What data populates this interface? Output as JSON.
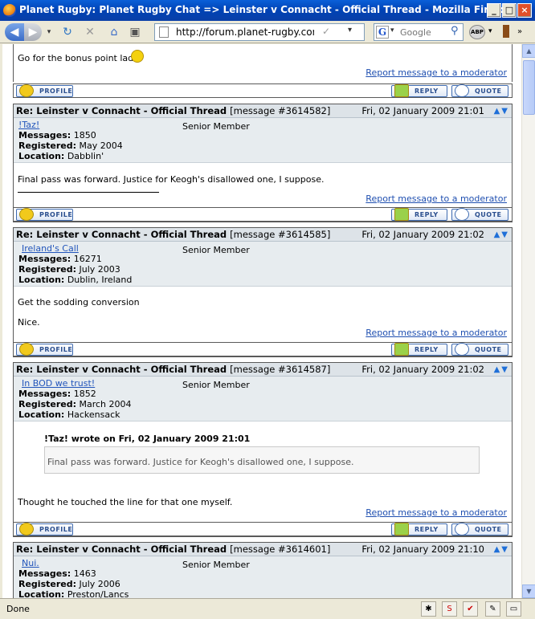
{
  "window": {
    "title": "Planet Rugby: Planet Rugby Chat => Leinster v Connacht - Official Thread - Mozilla Firefox"
  },
  "nav": {
    "url": "http://forum.planet-rugby.com/inde",
    "search_placeholder": "Google",
    "abp_label": "ABP"
  },
  "labels": {
    "profile": "PROFILE",
    "reply": "REPLY",
    "quote": "QUOTE",
    "report": "Report message to a moderator",
    "messages": "Messages:",
    "registered": "Registered:",
    "location": "Location:"
  },
  "top_post": {
    "text": "Go for the bonus point lads!"
  },
  "posts": [
    {
      "subject": "Re: Leinster v Connacht - Official Thread",
      "msgid": "[message #3614582]",
      "date": "Fri, 02 January 2009 21:01",
      "user": "!Taz!",
      "rank": "Senior Member",
      "messages": "1850",
      "registered": "May 2004",
      "location": "Dabblin'",
      "body": [
        "Final pass was forward. Justice for Keogh's disallowed one, I suppose."
      ]
    },
    {
      "subject": "Re: Leinster v Connacht - Official Thread",
      "msgid": "[message #3614585]",
      "date": "Fri, 02 January 2009 21:02",
      "user": "Ireland's Call",
      "rank": "Senior Member",
      "messages": "16271",
      "registered": "July 2003",
      "location": "Dublin, Ireland",
      "body": [
        "Get the sodding conversion",
        "Nice."
      ]
    },
    {
      "subject": "Re: Leinster v Connacht - Official Thread",
      "msgid": "[message #3614587]",
      "date": "Fri, 02 January 2009 21:02",
      "user": "In BOD we trust!",
      "rank": "Senior Member",
      "messages": "1852",
      "registered": "March 2004",
      "location": "Hackensack",
      "quote_header": "!Taz! wrote on Fri, 02 January 2009 21:01",
      "quote_text": "Final pass was forward. Justice for Keogh's disallowed one, I suppose.",
      "body": [
        "Thought he touched the line for that one myself."
      ]
    },
    {
      "subject": "Re: Leinster v Connacht - Official Thread",
      "msgid": "[message #3614601]",
      "date": "Fri, 02 January 2009 21:10",
      "user": "Nui.",
      "rank": "Senior Member",
      "messages": "1463",
      "registered": "July 2006",
      "location": "Preston/Lancs"
    }
  ],
  "status": {
    "text": "Done"
  }
}
